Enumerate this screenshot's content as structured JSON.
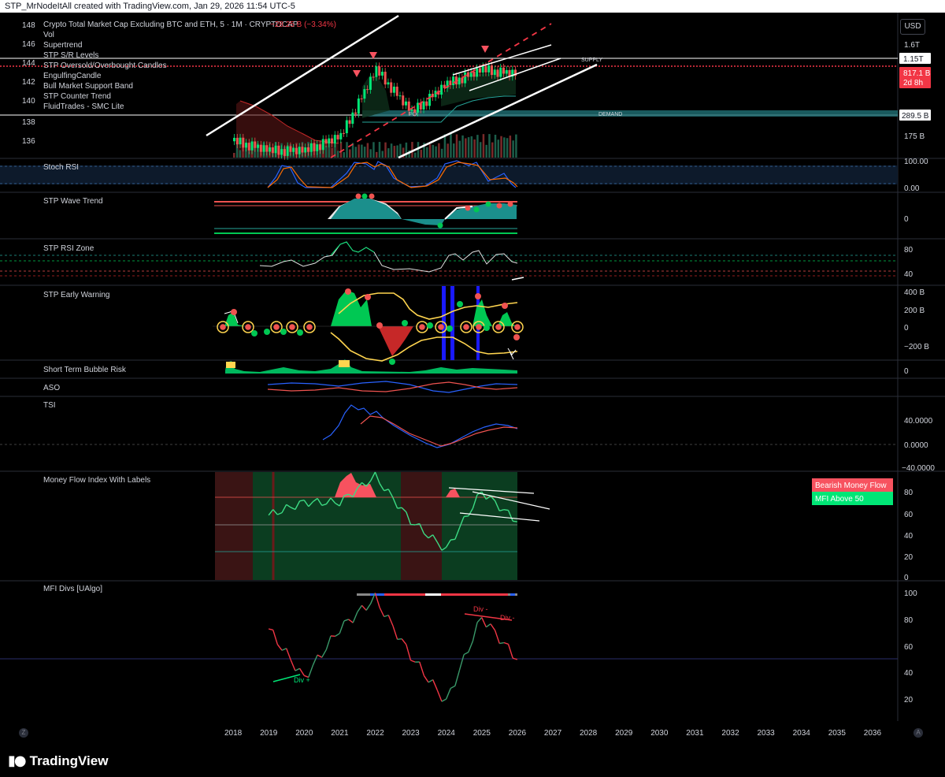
{
  "header": {
    "caption": "STP_MrNodeItAll created with TradingView.com, Jan 29, 2026 11:54 UTC-5"
  },
  "currency_button": "USD",
  "footer": {
    "brand": "TradingView",
    "left_button": "Z",
    "right_button": "A"
  },
  "main_pane": {
    "title": "Crypto Total Market Cap Excluding BTC and ETH, 5 · 1M · CRYPTOCAP",
    "change": "−28.25 B (−3.34%)",
    "indicators": [
      "Vol",
      "Supertrend",
      "STP S/R Levels",
      "STP Oversold/Overbought Candles",
      "EngulfingCandle",
      "Bull Market Support Band",
      "STP Counter Trend",
      "FluidTrades - SMC Lite"
    ],
    "y_ticks": [
      "148",
      "146",
      "144",
      "142",
      "140",
      "138",
      "136"
    ],
    "right_axis_labels": [
      "1.6T",
      "175 B"
    ],
    "price_tags": [
      {
        "text": "1.15T",
        "style": "white"
      },
      {
        "text": "817.1 B",
        "style": "red"
      },
      {
        "text": "2d 8h",
        "style": "red"
      },
      {
        "text": "289.5 B",
        "style": "white"
      }
    ],
    "zone_labels": {
      "supply": "SUPPLY",
      "demand": "DEMAND",
      "poi": "POI"
    }
  },
  "panes": {
    "stoch_rsi": {
      "title": "Stoch RSI",
      "ticks": [
        "100.00",
        "0.00"
      ]
    },
    "wave_trend": {
      "title": "STP Wave Trend",
      "ticks": [
        "0"
      ]
    },
    "rsi_zone": {
      "title": "STP RSI Zone",
      "ticks": [
        "80",
        "40"
      ]
    },
    "early_warning": {
      "title": "STP Early Warning",
      "ticks": [
        "400 B",
        "200 B",
        "0",
        "−200 B"
      ]
    },
    "bubble_risk": {
      "title": "Short Term Bubble Risk",
      "ticks": [
        "0"
      ]
    },
    "aso": {
      "title": "ASO",
      "ticks": []
    },
    "tsi": {
      "title": "TSI",
      "ticks": [
        "40.0000",
        "0.0000",
        "−40.0000"
      ]
    },
    "mfi": {
      "title": "Money Flow Index With Labels",
      "ticks": [
        "80",
        "60",
        "40",
        "20",
        "0"
      ],
      "legend": [
        {
          "text": "Bearish Money Flow",
          "color": "#f7525f"
        },
        {
          "text": "MFI Above 50",
          "color": "#00e676"
        }
      ]
    },
    "mfi_divs": {
      "title": "MFI Divs [UAlgo]",
      "ticks": [
        "100",
        "80",
        "60",
        "40",
        "20"
      ],
      "labels": [
        "Div -",
        "Div -",
        "Div +"
      ]
    }
  },
  "x_axis": {
    "labels": [
      "2018",
      "2019",
      "2020",
      "2021",
      "2022",
      "2023",
      "2024",
      "2025",
      "2026",
      "2027",
      "2028",
      "2029",
      "2030",
      "2031",
      "2032",
      "2033",
      "2034",
      "2035",
      "2036"
    ]
  },
  "colors": {
    "bull": "#26a69a",
    "bull_bright": "#00e676",
    "bear": "#ef5350",
    "bg": "#000000",
    "grid": "#1e222d",
    "accent_red": "#f23645",
    "mfi_zone_green": "#0b3d20",
    "mfi_zone_red": "#3a1414"
  },
  "chart_data": [
    {
      "type": "line",
      "title": "Crypto Total Market Cap Excluding BTC and ETH",
      "x": [
        "2018",
        "2019",
        "2020",
        "2021",
        "2022",
        "2023",
        "2024",
        "2025",
        "2026"
      ],
      "series": [
        {
          "values": [
            136.5,
            135.5,
            135.5,
            137,
            144,
            139.5,
            142.5,
            144,
            143.5
          ]
        }
      ],
      "ylim": [
        135,
        149
      ]
    },
    {
      "type": "line",
      "title": "Money Flow Index With Labels",
      "x": [
        "2018",
        "2019",
        "2020",
        "2021",
        "2022",
        "2023",
        "2024",
        "2025",
        "2026"
      ],
      "series": [
        {
          "values": [
            null,
            60,
            72,
            72,
            96,
            55,
            28,
            82,
            54
          ]
        }
      ],
      "ylim": [
        0,
        100
      ]
    },
    {
      "type": "line",
      "title": "MFI Divs [UAlgo]",
      "x": [
        "2018",
        "2019",
        "2020",
        "2021",
        "2022",
        "2023",
        "2024",
        "2025",
        "2026"
      ],
      "series": [
        {
          "values": [
            null,
            75,
            38,
            75,
            98,
            55,
            20,
            84,
            52
          ]
        }
      ],
      "ylim": [
        10,
        105
      ]
    }
  ]
}
